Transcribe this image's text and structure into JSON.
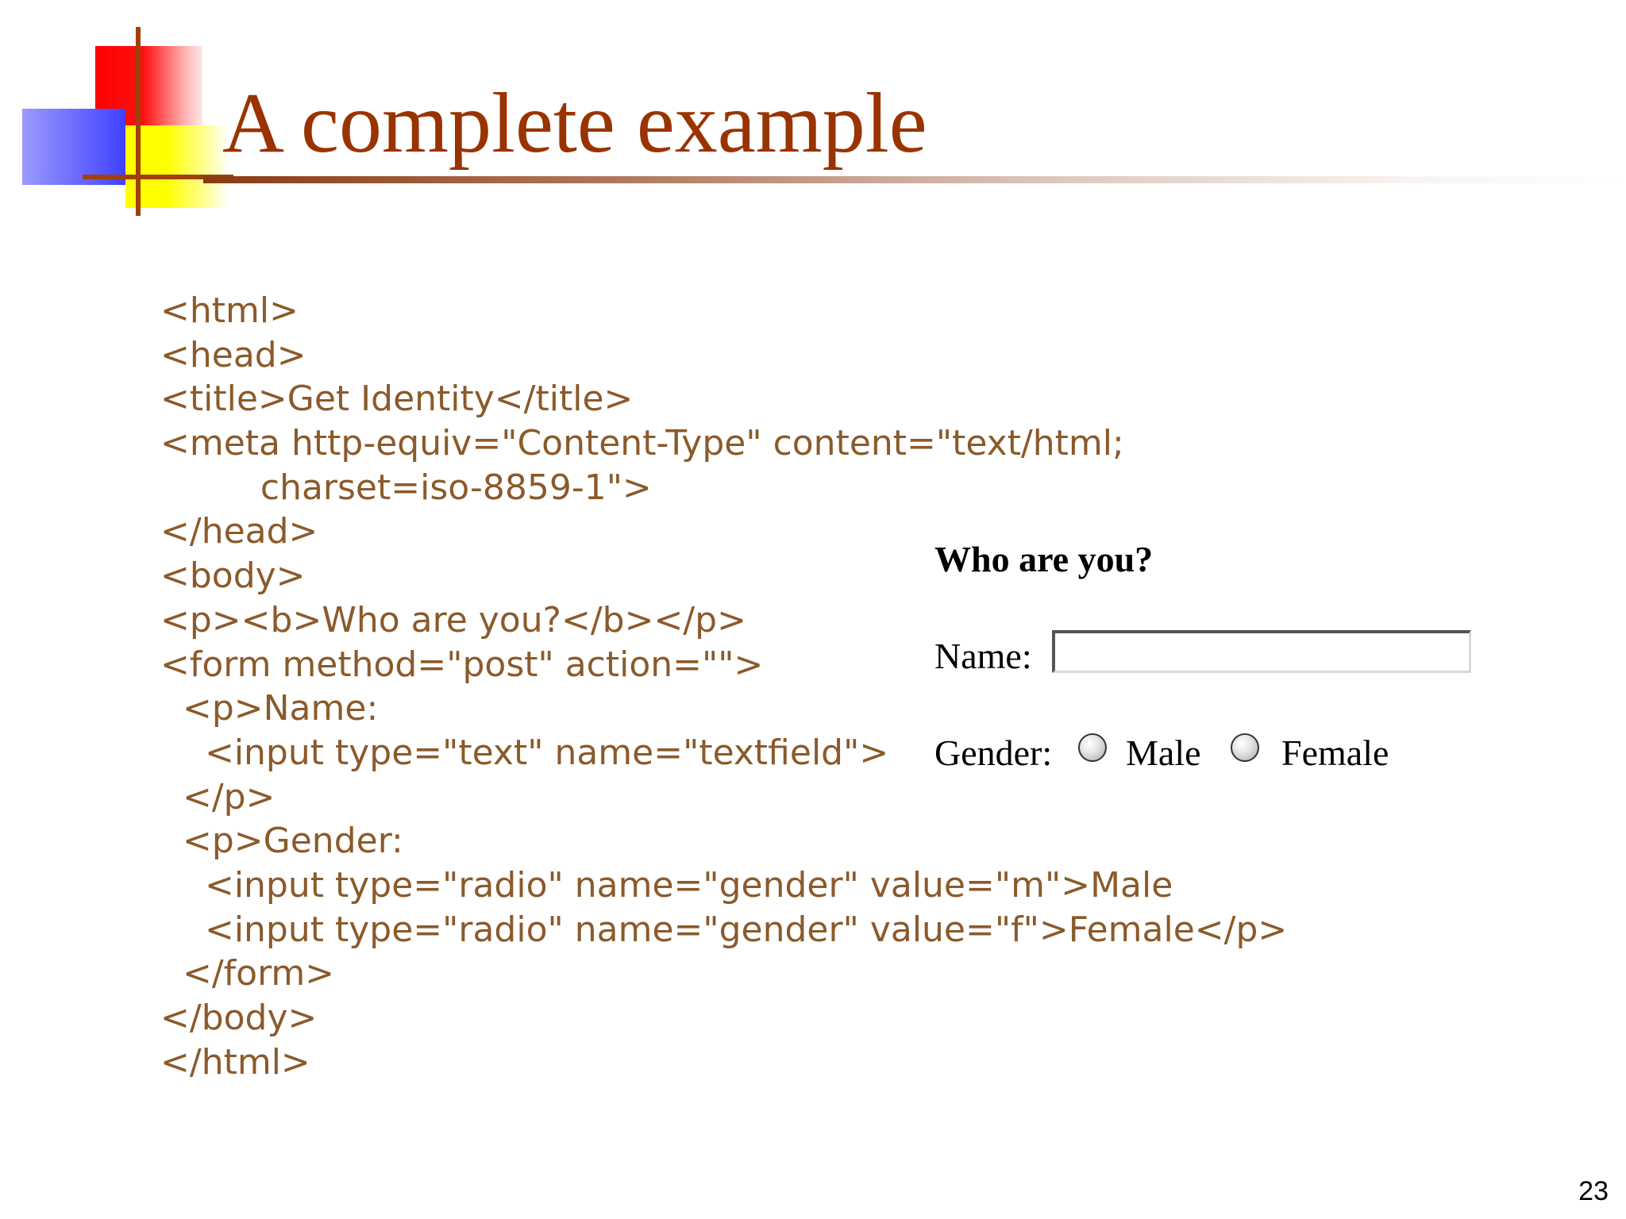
{
  "slide": {
    "title": "A complete example",
    "page_number": "23"
  },
  "code_lines": [
    "<html>",
    "<head>",
    "<title>Get Identity</title>",
    "<meta http-equiv=\"Content-Type\" content=\"text/html;",
    "         charset=iso-8859-1\">",
    "</head>",
    "<body>",
    "<p><b>Who are you?</b></p>",
    "<form method=\"post\" action=\"\">",
    "  <p>Name:",
    "    <input type=\"text\" name=\"textfield\">",
    "  </p>",
    "  <p>Gender:",
    "    <input type=\"radio\" name=\"gender\" value=\"m\">Male",
    "    <input type=\"radio\" name=\"gender\" value=\"f\">Female</p>",
    "  </form>",
    "</body>",
    "</html>"
  ],
  "preview": {
    "heading": "Who are you?",
    "name_label": "Name:",
    "name_value": "",
    "gender_label": "Gender:",
    "option_male": "Male",
    "option_female": "Female"
  },
  "colors": {
    "title": "#993300",
    "code_text": "#8b5a2b",
    "logo_red": "#ff0000",
    "logo_blue": "#4040ff",
    "logo_yellow": "#ffff00",
    "logo_lines": "#a0400a"
  }
}
